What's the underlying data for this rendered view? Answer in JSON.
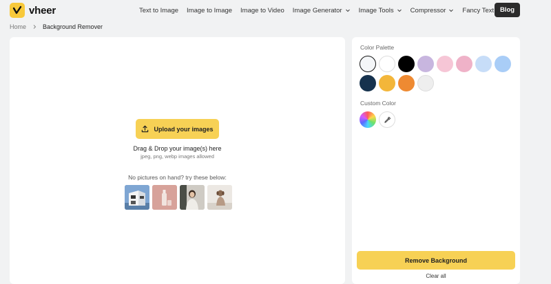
{
  "brand": {
    "name": "vheer",
    "logo_color": "#f8c93a"
  },
  "nav": {
    "items": [
      {
        "label": "Text to Image",
        "dropdown": false
      },
      {
        "label": "Image to Image",
        "dropdown": false
      },
      {
        "label": "Image to Video",
        "dropdown": false
      },
      {
        "label": "Image Generator",
        "dropdown": true
      },
      {
        "label": "Image Tools",
        "dropdown": true
      },
      {
        "label": "Compressor",
        "dropdown": true
      },
      {
        "label": "Fancy Text",
        "dropdown": true
      }
    ],
    "blog_label": "Blog"
  },
  "breadcrumb": {
    "home": "Home",
    "current": "Background Remover"
  },
  "upload": {
    "button_label": "Upload your images",
    "drag_title": "Drag & Drop your image(s) here",
    "drag_sub": "jpeg, png, webp images allowed",
    "try_text": "No pictures on hand? try these below:",
    "samples": [
      {
        "name": "building",
        "icon": "sample-building-thumbnail"
      },
      {
        "name": "bottle",
        "icon": "sample-bottle-thumbnail"
      },
      {
        "name": "woman",
        "icon": "sample-woman-thumbnail"
      },
      {
        "name": "dog",
        "icon": "sample-dog-thumbnail"
      }
    ]
  },
  "palette": {
    "label": "Color Palette",
    "colors": [
      "#f4f6f8",
      "#ffffff",
      "#000000",
      "#c8b6df",
      "#f6c6d6",
      "#efb2c8",
      "#c7ddf8",
      "#a9cdf7",
      "#16324d",
      "#f3b63a",
      "#ee8a32",
      "#eeeeee"
    ],
    "selected": 0
  },
  "custom": {
    "label": "Custom Color",
    "icons": [
      "color-wheel-icon",
      "eyedropper-icon"
    ]
  },
  "actions": {
    "remove_label": "Remove Background",
    "clear_label": "Clear all"
  },
  "accent_color": "#f7d155"
}
